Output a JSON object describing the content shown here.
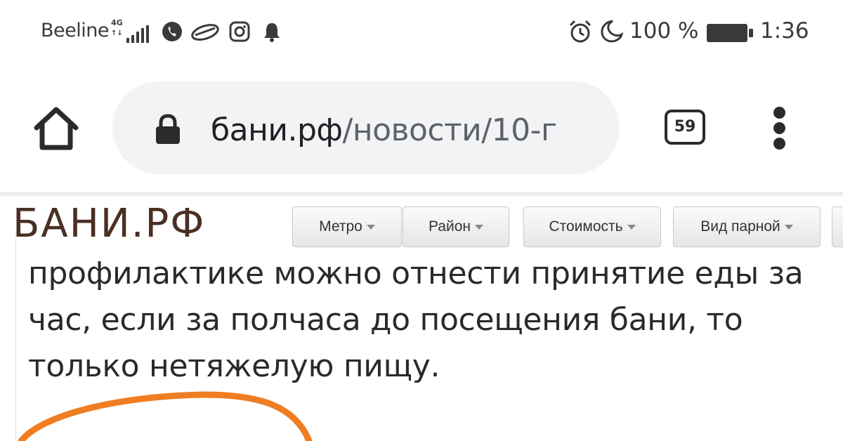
{
  "status_bar": {
    "carrier": "Beeline",
    "network_type": "4G",
    "battery_percent": "100 %",
    "time": "1:36",
    "left_icons": [
      "signal-icon",
      "phone-call-icon",
      "cloud-sync-icon",
      "instagram-icon",
      "notification-bell-icon"
    ],
    "right_icons": [
      "alarm-clock-icon",
      "do-not-disturb-moon-icon",
      "battery-icon"
    ]
  },
  "toolbar": {
    "url_host": "бани.рф",
    "url_path": "/новости/10-г",
    "tab_count": "59",
    "icons": [
      "home-icon",
      "lock-icon",
      "overflow-menu-icon"
    ]
  },
  "site": {
    "logo": "БАНИ.РФ",
    "filters": [
      {
        "label": "Метро"
      },
      {
        "label": "Район"
      },
      {
        "label": "Стоимость"
      },
      {
        "label": "Вид парной"
      }
    ]
  },
  "article": {
    "lines": [
      "профилактике можно отнести  принятие еды за",
      "час, если за полчаса до посещения бани, то",
      "только нетяжелую пищу."
    ]
  },
  "colors": {
    "logo": "#4a2f23",
    "url_bar_bg": "#f1f3f4",
    "annotation_stroke": "#ef7d22"
  }
}
